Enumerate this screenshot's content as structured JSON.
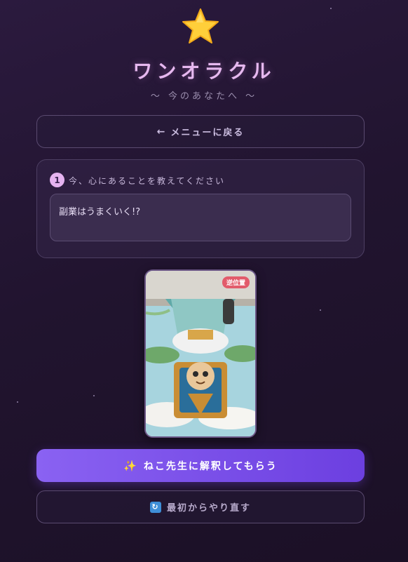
{
  "app": {
    "title": "ワンオラクル",
    "subtitle": "〜 今のあなたへ 〜",
    "logo_icon": "star-icon"
  },
  "nav": {
    "back_arrow": "←",
    "back_label": "メニューに戻る"
  },
  "question": {
    "step_number": "1",
    "label": "今、心にあることを教えてください",
    "value": "副業はうまくいく!?"
  },
  "card": {
    "orientation_badge": "逆位置",
    "icon": "tarot-card-cat-king"
  },
  "actions": {
    "interpret_icon": "✨",
    "interpret_label": "ねこ先生に解釈してもらう",
    "restart_icon": "🔄",
    "restart_label": "最初からやり直す"
  },
  "colors": {
    "accent": "#7b4fea",
    "title": "#e6b8ef",
    "badge": "#e25b6b"
  }
}
